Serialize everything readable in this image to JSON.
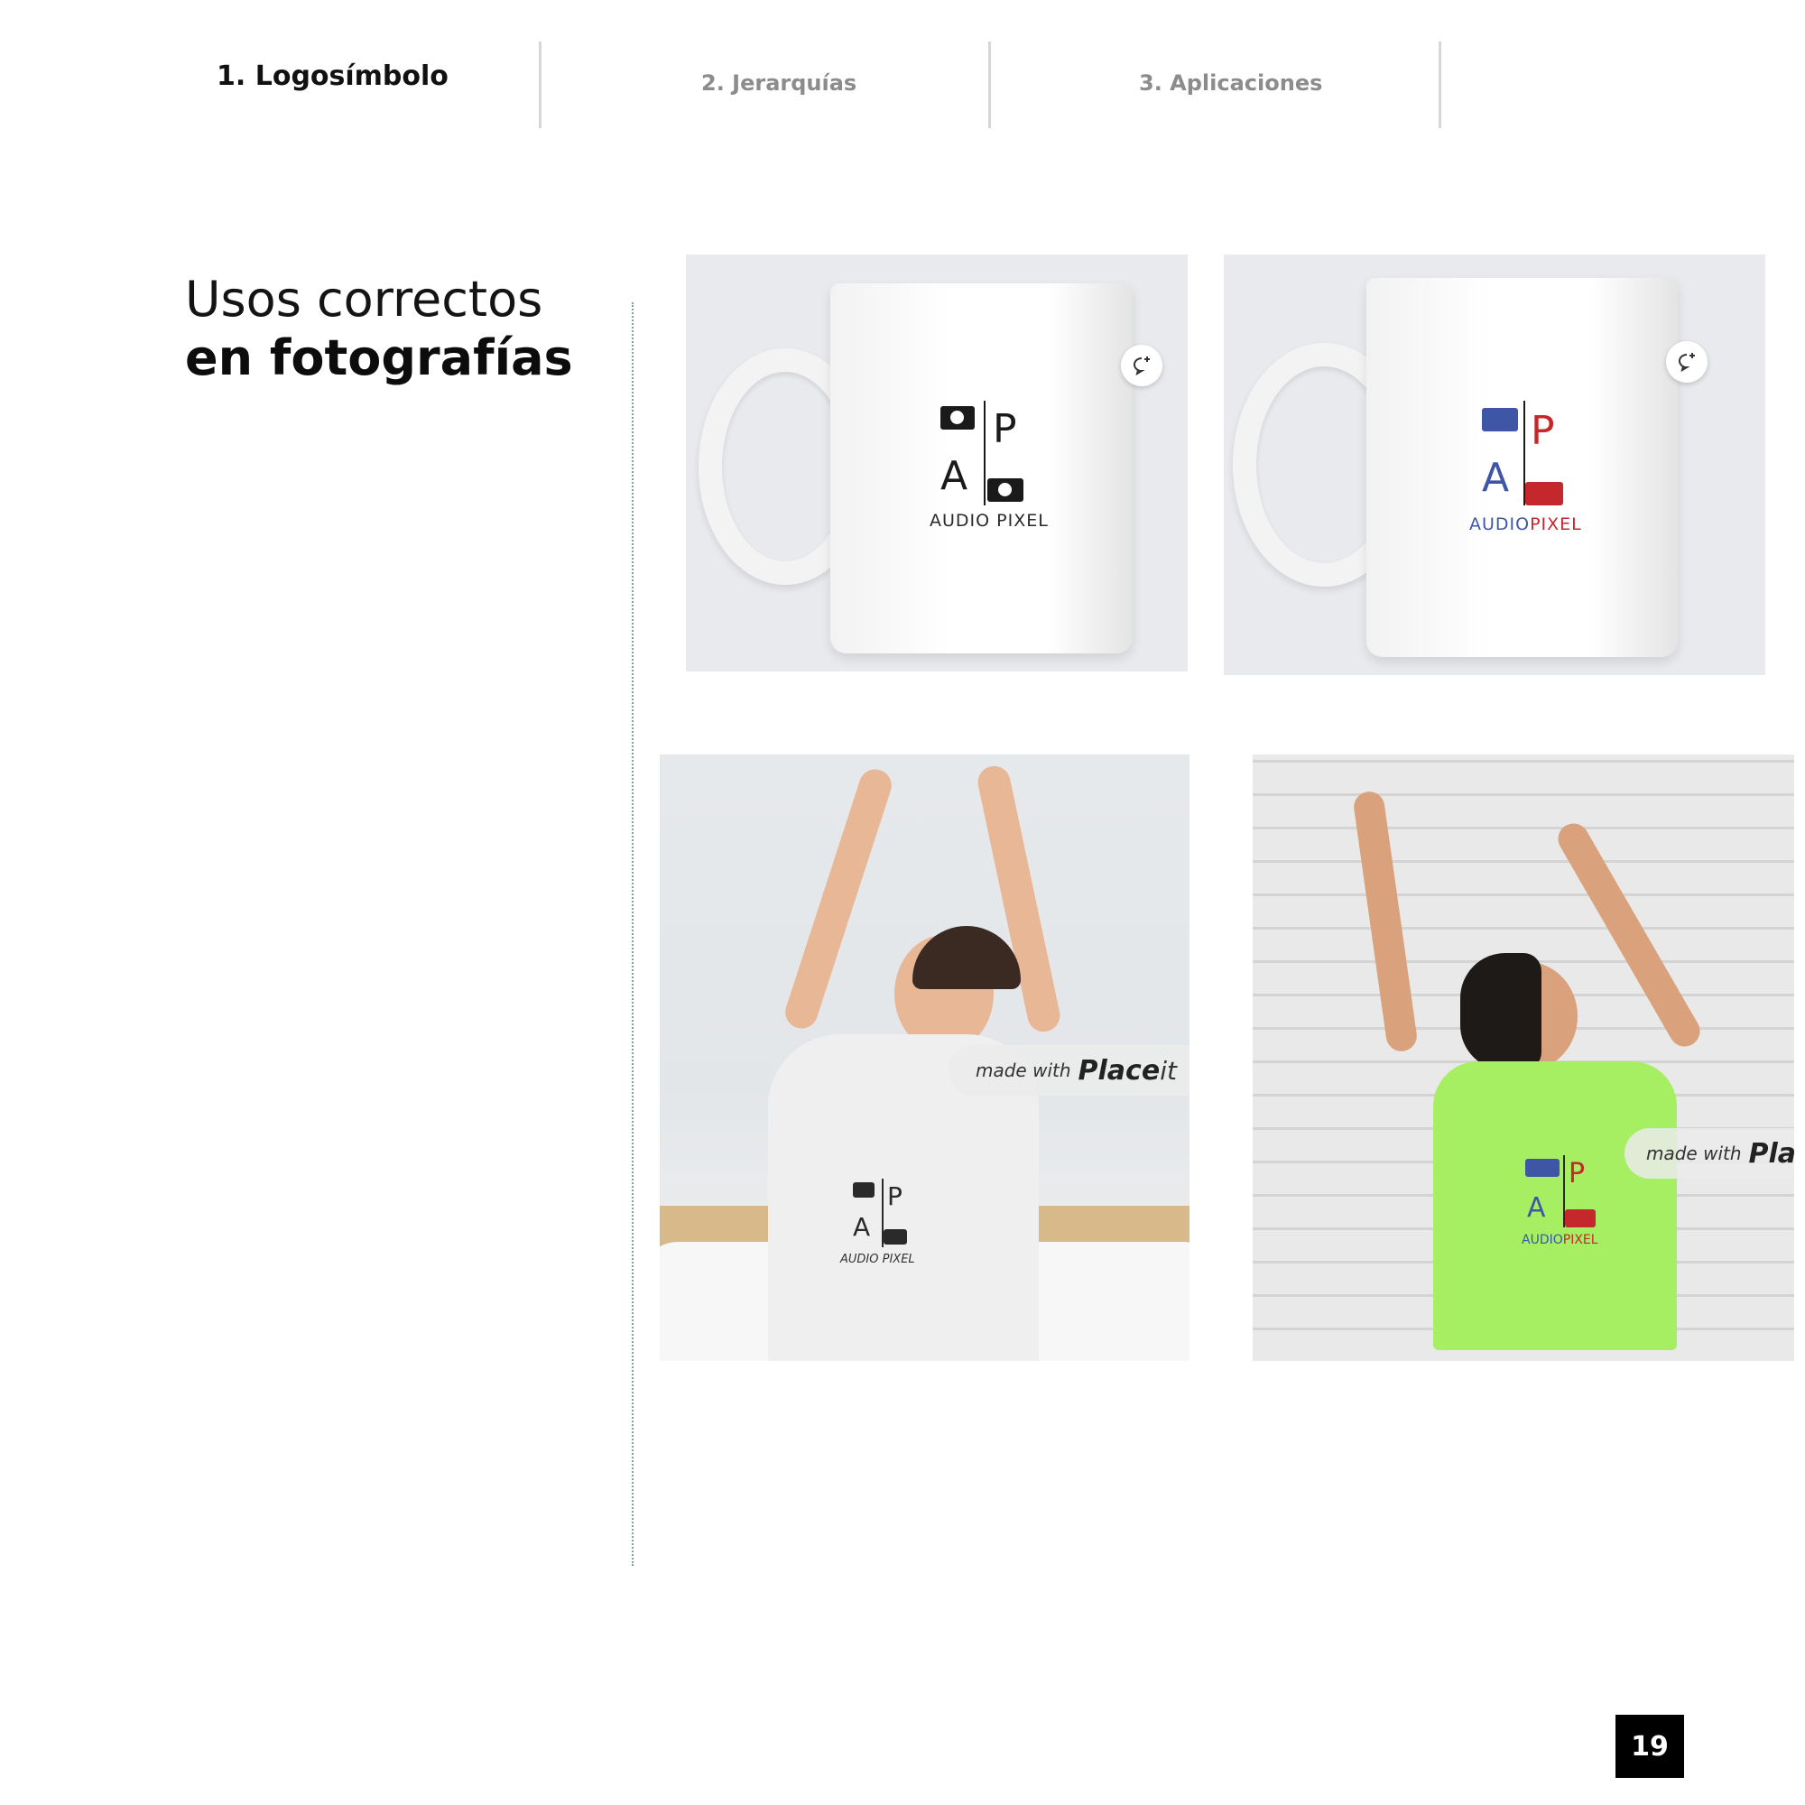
{
  "nav": {
    "tabs": [
      {
        "label": "1. Logosímbolo",
        "active": true
      },
      {
        "label": "2. Jerarquías",
        "active": false
      },
      {
        "label": "3. Aplicaciones",
        "active": false
      }
    ]
  },
  "section": {
    "title_light": "Usos correctos",
    "title_bold": "en fotografías"
  },
  "logo": {
    "letter_top": "P",
    "letter_bottom": "A",
    "brand_full": "AUDIO PIXEL",
    "brand_part1": "AUDIO",
    "brand_part2": "PIXEL"
  },
  "watermark": {
    "small": "made with",
    "brand_left": "Place",
    "brand_right": "it",
    "brand_cropped": "Plac"
  },
  "colors": {
    "logo_blue": "#3f56a6",
    "logo_red": "#c4282d",
    "logo_black": "#1a1a1a",
    "shirt_green": "#a6ef62"
  },
  "icons": {
    "mug_badge": "add-comment-icon",
    "logo_camera": "camera-icon"
  },
  "footer": {
    "page_number": "19"
  }
}
